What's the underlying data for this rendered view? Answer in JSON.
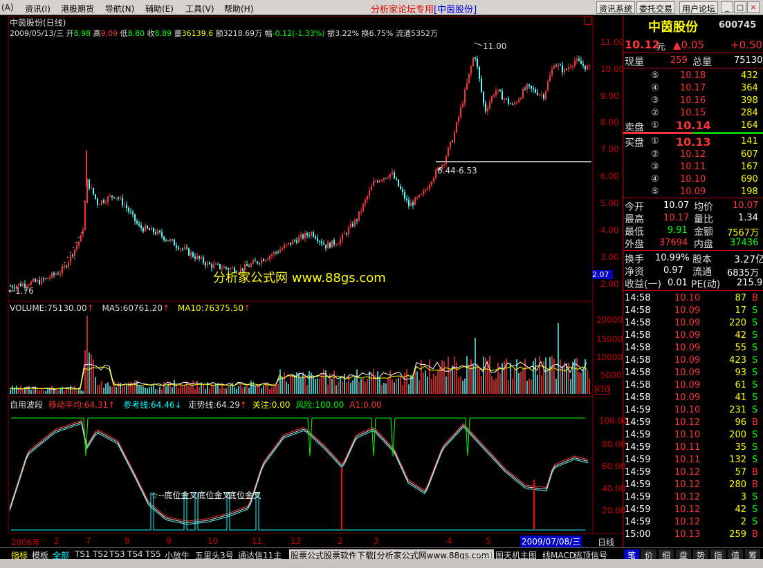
{
  "menu": {
    "items": [
      "(A)",
      "资讯(I)",
      "港股期货",
      "导航(N)",
      "辅助(E)",
      "工具(V)",
      "帮助(H)"
    ],
    "center_left": "分析家论坛专用",
    "center_right": "[中茵股份]",
    "right_buttons": [
      "资讯系统",
      "委托交易",
      "用户论坛"
    ],
    "window_buttons": [
      "_",
      "□",
      "×"
    ]
  },
  "chart": {
    "title": "中茵股份(日线)",
    "info": {
      "date": "2009/05/13/三",
      "open_label": "开",
      "open": "8.98",
      "high_label": "高",
      "high": "9.09",
      "low_label": "低",
      "low": "8.80",
      "close_label": "收",
      "close": "8.89",
      "vol_label": "量",
      "vol": "36139.6",
      "amount_label": "额",
      "amount": "3218.69万",
      "change_label": "幅",
      "change": "-0.12(-1.33%)",
      "amp_label": "振",
      "amp": "3.22%",
      "turn_label": "换",
      "turn": "6.75%",
      "float_label": "流通",
      "float": "5352万"
    },
    "price_axis": [
      "11.00",
      "10.00",
      "9.00",
      "8.00",
      "7.00",
      "6.00",
      "5.00",
      "4.00",
      "3.00",
      "2.00"
    ],
    "price_tag": "2.07",
    "high_marker": "11.00",
    "low_marker": "1.76",
    "range_label": "6.44-6.53",
    "watermark": "分析家公式网 www.88gs.com",
    "volume_labels": {
      "vol": "VOLUME:75130.00",
      "ma5": "MA5:60761.20",
      "ma10": "MA10:76375.50"
    },
    "volume_axis": [
      "20000",
      "15000",
      "10000",
      "5000"
    ],
    "volume_unit": "X10",
    "indicator_labels": {
      "name": "自用波段",
      "ma": "移动平均:64.31",
      "ref": "参考线:64.46",
      "trend": "走势线:64.29",
      "focus": "关注:0.00",
      "risk": "风险:100.00",
      "a1": "A1:0.00"
    },
    "indicator_axis": [
      "100.00",
      "80.00",
      "60.00",
      "40.00",
      "20.00"
    ],
    "signal_text": "☆--底位金叉底位金叉",
    "signal_text2": "底位金叉",
    "date_axis": [
      "2006年",
      "2",
      "7",
      "8",
      "9",
      "10",
      "11",
      "12",
      "2",
      "3",
      "4",
      "5"
    ],
    "date_tag": "2009/07/08/三",
    "period": "日线"
  },
  "quote": {
    "name": "中茵股份",
    "code": "600745",
    "price": "10.12",
    "price_unit": "元",
    "change": "▲0.05",
    "change2": "+0.50",
    "now_vol_label": "现量",
    "now_vol": "259",
    "total_vol_label": "总量",
    "total_vol": "75130",
    "sells": [
      {
        "n": "⑤",
        "p": "10.18",
        "v": "432"
      },
      {
        "n": "④",
        "p": "10.17",
        "v": "364"
      },
      {
        "n": "③",
        "p": "10.16",
        "v": "398"
      },
      {
        "n": "②",
        "p": "10.15",
        "v": "284"
      },
      {
        "n": "①",
        "p": "10.14",
        "v": "164"
      }
    ],
    "sell_label": "卖盘",
    "buy_label": "买盘",
    "buys": [
      {
        "n": "①",
        "p": "10.13",
        "v": "141"
      },
      {
        "n": "②",
        "p": "10.12",
        "v": "607"
      },
      {
        "n": "③",
        "p": "10.11",
        "v": "167"
      },
      {
        "n": "④",
        "p": "10.10",
        "v": "690"
      },
      {
        "n": "⑤",
        "p": "10.09",
        "v": "198"
      }
    ],
    "stats": [
      {
        "l1": "今开",
        "v1": "10.07",
        "l2": "均价",
        "v2": "10.07"
      },
      {
        "l1": "最高",
        "v1": "10.17",
        "l2": "量比",
        "v2": "1.34"
      },
      {
        "l1": "最低",
        "v1": "9.91",
        "l2": "金额",
        "v2": "7567万"
      },
      {
        "l1": "外盘",
        "v1": "37694",
        "l2": "内盘",
        "v2": "37436"
      }
    ],
    "stats2": [
      {
        "l1": "换手",
        "v1": "10.99%",
        "l2": "股本",
        "v2": "3.27亿"
      },
      {
        "l1": "净资",
        "v1": "0.97",
        "l2": "流通",
        "v2": "6835万"
      },
      {
        "l1": "收益(一)",
        "v1": "0.01",
        "l2": "PE(动)",
        "v2": "215.9"
      }
    ],
    "ticks": [
      {
        "t": "14:58",
        "p": "10.10",
        "v": "87",
        "d": "B"
      },
      {
        "t": "14:58",
        "p": "10.09",
        "v": "17",
        "d": "S"
      },
      {
        "t": "14:58",
        "p": "10.09",
        "v": "220",
        "d": "S"
      },
      {
        "t": "14:58",
        "p": "10.09",
        "v": "42",
        "d": "S"
      },
      {
        "t": "14:58",
        "p": "10.09",
        "v": "55",
        "d": "S"
      },
      {
        "t": "14:58",
        "p": "10.09",
        "v": "423",
        "d": "S"
      },
      {
        "t": "14:58",
        "p": "10.09",
        "v": "93",
        "d": "S"
      },
      {
        "t": "14:58",
        "p": "10.09",
        "v": "61",
        "d": "S"
      },
      {
        "t": "14:58",
        "p": "10.09",
        "v": "41",
        "d": "S"
      },
      {
        "t": "14:59",
        "p": "10.10",
        "v": "231",
        "d": "S"
      },
      {
        "t": "14:59",
        "p": "10.12",
        "v": "96",
        "d": "B"
      },
      {
        "t": "14:59",
        "p": "10.10",
        "v": "200",
        "d": "S"
      },
      {
        "t": "14:59",
        "p": "10.11",
        "v": "35",
        "d": "S"
      },
      {
        "t": "14:59",
        "p": "10.11",
        "v": "132",
        "d": "S"
      },
      {
        "t": "14:59",
        "p": "10.12",
        "v": "57",
        "d": "B"
      },
      {
        "t": "14:59",
        "p": "10.12",
        "v": "280",
        "d": "B"
      },
      {
        "t": "14:59",
        "p": "10.12",
        "v": "3",
        "d": "S"
      },
      {
        "t": "14:59",
        "p": "10.12",
        "v": "42",
        "d": "S"
      },
      {
        "t": "14:59",
        "p": "10.12",
        "v": "2",
        "d": "S"
      },
      {
        "t": "15:00",
        "p": "10.13",
        "v": "259",
        "d": "B"
      }
    ]
  },
  "tabs": [
    "指标",
    "模板",
    "全部",
    "TS1",
    "TS2",
    "TS3",
    "TS4",
    "TS5",
    "小放牛",
    "五里头3号",
    "通达信11主",
    "股票公式股票软件下载[分析家公式网www.88gs.com]",
    "DC",
    "主图天机主图",
    "线MACD",
    "逃顶信号"
  ],
  "right_tabs": [
    "笔",
    "价",
    "细",
    "盘",
    "势",
    "指",
    "值",
    "筹"
  ]
}
